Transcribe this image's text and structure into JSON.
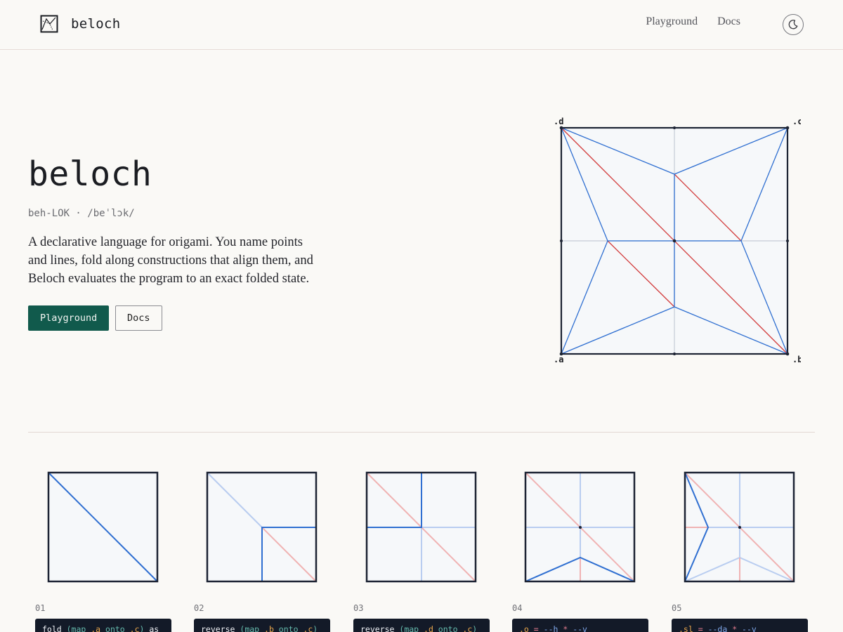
{
  "header": {
    "brand_name": "beloch",
    "logo_icon": "crease-pattern-logo-icon",
    "nav": [
      {
        "label": "Playground"
      },
      {
        "label": "Docs"
      }
    ],
    "theme_toggle_icon": "moon-icon"
  },
  "hero": {
    "title": "beloch",
    "pronunciation": "beh-LOK · /beˈlɔk/",
    "description": "A declarative language for origami. You name points and lines, fold along constructions that align them, and Beloch evaluates the program to an exact folded state.",
    "primary_button": "Playground",
    "secondary_button": "Docs",
    "diagram": {
      "corner_labels": {
        "a": ".a",
        "b": ".b",
        "c": ".c",
        "d": ".d"
      },
      "colors": {
        "paper": "#f6f8fa",
        "border": "#1c2333",
        "mountain": "#2f6fd1",
        "valley": "#d23a3a",
        "guide": "#c5cbd6"
      }
    }
  },
  "steps": [
    {
      "number": "01",
      "code": [
        [
          "kw",
          "fold "
        ],
        [
          "fn",
          "(map "
        ],
        [
          "pt",
          ".a"
        ],
        [
          "fn",
          " onto "
        ],
        [
          "pt",
          ".c"
        ],
        [
          "fn",
          ")"
        ],
        [
          "kw",
          " as"
        ]
      ]
    },
    {
      "number": "02",
      "code": [
        [
          "kw",
          "reverse "
        ],
        [
          "fn",
          "(map "
        ],
        [
          "pt",
          ".b"
        ],
        [
          "fn",
          " onto "
        ],
        [
          "pt",
          ".c"
        ],
        [
          "fn",
          ")"
        ]
      ]
    },
    {
      "number": "03",
      "code": [
        [
          "kw",
          "reverse "
        ],
        [
          "fn",
          "(map "
        ],
        [
          "pt",
          ".d"
        ],
        [
          "fn",
          " onto "
        ],
        [
          "pt",
          ".c"
        ],
        [
          "fn",
          ")"
        ]
      ]
    },
    {
      "number": "04",
      "code": [
        [
          "pt",
          ".o"
        ],
        [
          "op",
          " = "
        ],
        [
          "var",
          "--h"
        ],
        [
          "op",
          " * "
        ],
        [
          "var",
          "--v"
        ]
      ]
    },
    {
      "number": "05",
      "code": [
        [
          "pt",
          ".sl"
        ],
        [
          "op",
          " = "
        ],
        [
          "var",
          "--da"
        ],
        [
          "op",
          " * "
        ],
        [
          "var",
          "--v"
        ]
      ]
    }
  ]
}
